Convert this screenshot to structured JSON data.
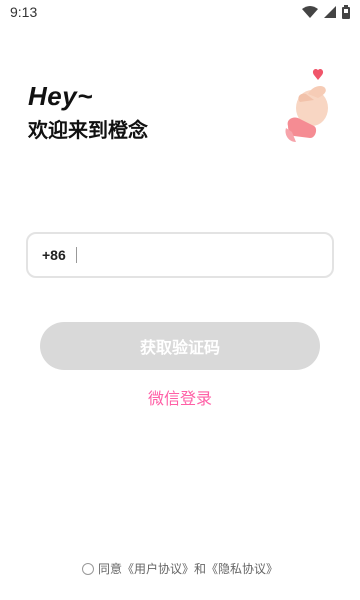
{
  "status_bar": {
    "time": "9:13",
    "icons": [
      "wifi-icon",
      "signal-icon",
      "battery-icon"
    ]
  },
  "greeting": {
    "hey": "Hey~",
    "welcome": "欢迎来到橙念"
  },
  "phone": {
    "country_code": "+86",
    "value": "",
    "placeholder": ""
  },
  "buttons": {
    "get_code": "获取验证码",
    "wechat_login": "微信登录"
  },
  "agreement": {
    "agree": "同意",
    "user_agreement": "《用户协议》",
    "and": "和",
    "privacy_agreement": "《隐私协议》"
  },
  "colors": {
    "accent_pink": "#ff5fa6",
    "button_disabled": "#d9d9d9",
    "input_border": "#e3e3e3"
  }
}
